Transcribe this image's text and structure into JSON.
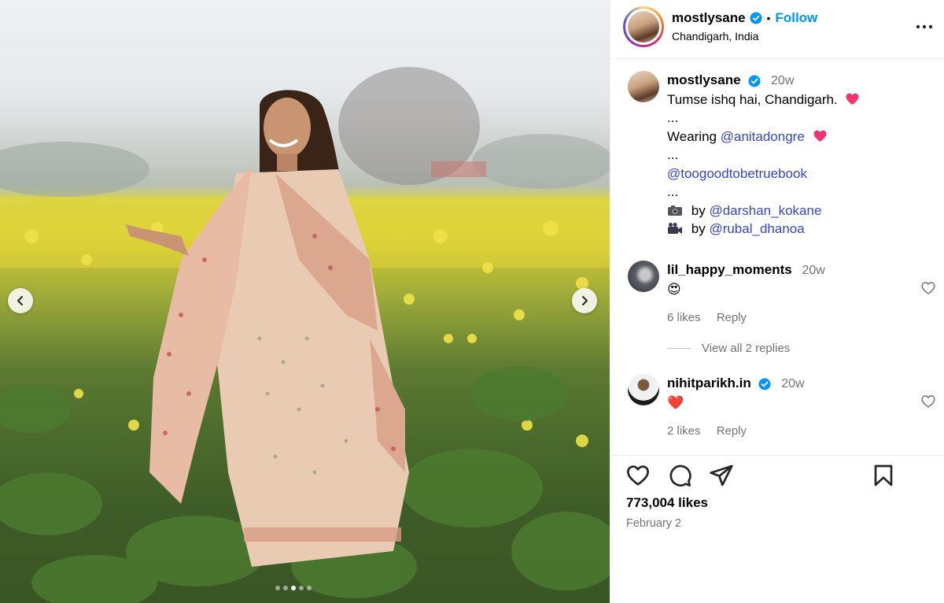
{
  "post": {
    "author": "mostlysane",
    "follow_label": "Follow",
    "separator": "•",
    "location": "Chandigarh, India",
    "carousel": {
      "slide_count": 5,
      "active_index": 2
    }
  },
  "caption": {
    "username": "mostlysane",
    "time": "20w",
    "line1": "Tumse ishq hai, Chandigarh.",
    "dots1": "...",
    "wearing_prefix": "Wearing",
    "wearing_mention": "@anitadongre",
    "dots2": "...",
    "book_mention": "@toogoodtobetruebook",
    "dots3": "...",
    "photo_by_prefix": "by",
    "photo_by_mention": "@darshan_kokane",
    "video_by_prefix": "by",
    "video_by_mention": "@rubal_dhanoa"
  },
  "comments": [
    {
      "username": "lil_happy_moments",
      "time": "20w",
      "text": "😍",
      "likes": "6 likes",
      "reply_label": "Reply",
      "view_replies": "View all 2 replies"
    },
    {
      "username": "nihitparikh.in",
      "time": "20w",
      "text": "❤️",
      "likes": "2 likes",
      "reply_label": "Reply"
    }
  ],
  "footer": {
    "likes": "773,004 likes",
    "date": "February 2"
  },
  "icons": {
    "verified": "verified-badge-icon",
    "more": "more-options-icon",
    "like": "heart-outline-icon",
    "comment": "comment-bubble-icon",
    "share": "paper-plane-icon",
    "save": "bookmark-icon",
    "camera": "camera-emoji-icon",
    "video": "video-camera-emoji-icon"
  },
  "colors": {
    "accent": "#0095f6",
    "mention": "#3546c7",
    "secondary_text": "#737373",
    "heart": "#ed4956"
  }
}
